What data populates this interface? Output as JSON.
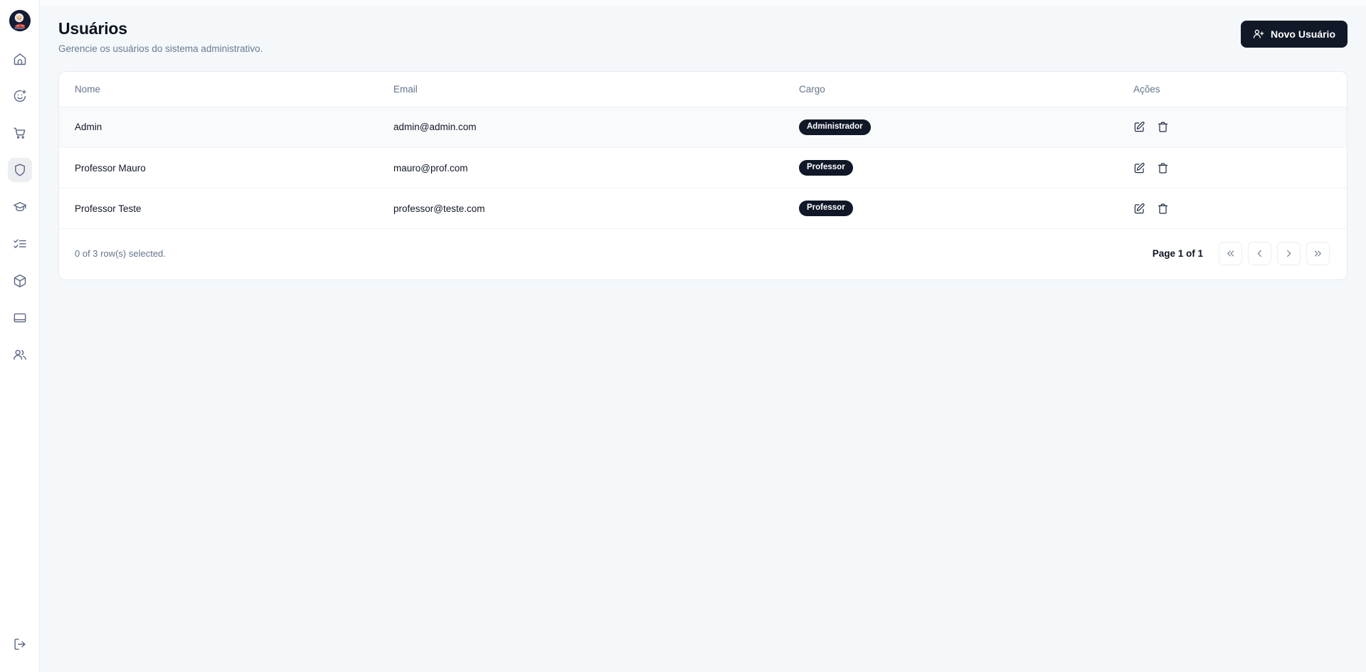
{
  "theme": {
    "accent": "#111827",
    "page_bg": "#f4f8fb",
    "card_bg": "#ffffff",
    "border": "#e6ebf2",
    "muted_text": "#64748b",
    "sidebar_icon": "#5b6785"
  },
  "sidebar": {
    "avatar_name": "user-avatar-astronaut",
    "items": [
      {
        "name": "sidebar-item-home",
        "icon": "home-icon",
        "active": false
      },
      {
        "name": "sidebar-item-add-user",
        "icon": "smiley-plus-icon",
        "active": false
      },
      {
        "name": "sidebar-item-store",
        "icon": "cart-icon",
        "active": false
      },
      {
        "name": "sidebar-item-admin",
        "icon": "shield-icon",
        "active": true
      },
      {
        "name": "sidebar-item-courses",
        "icon": "graduation-cap-icon",
        "active": false
      },
      {
        "name": "sidebar-item-tasks",
        "icon": "checklist-icon",
        "active": false
      },
      {
        "name": "sidebar-item-products",
        "icon": "box-icon",
        "active": false
      },
      {
        "name": "sidebar-item-library",
        "icon": "book-icon",
        "active": false
      },
      {
        "name": "sidebar-item-users",
        "icon": "users-icon",
        "active": false
      }
    ],
    "logout": {
      "name": "sidebar-item-logout",
      "icon": "logout-icon"
    }
  },
  "header": {
    "title": "Usuários",
    "subtitle": "Gerencie os usuários do sistema administrativo.",
    "new_user_label": "Novo Usuário",
    "new_user_icon": "user-plus-icon"
  },
  "table": {
    "columns": [
      {
        "key": "nome",
        "label": "Nome"
      },
      {
        "key": "email",
        "label": "Email"
      },
      {
        "key": "cargo",
        "label": "Cargo"
      },
      {
        "key": "acoes",
        "label": "Ações"
      }
    ],
    "rows": [
      {
        "nome": "Admin",
        "email": "admin@admin.com",
        "cargo": "Administrador",
        "selected": true
      },
      {
        "nome": "Professor Mauro",
        "email": "mauro@prof.com",
        "cargo": "Professor",
        "selected": false
      },
      {
        "nome": "Professor Teste",
        "email": "professor@teste.com",
        "cargo": "Professor",
        "selected": false
      }
    ],
    "row_actions": {
      "edit_icon": "edit-pencil-icon",
      "delete_icon": "trash-icon"
    }
  },
  "footer": {
    "rows_selected": "0 of 3 row(s) selected.",
    "page_indicator": "Page 1 of 1",
    "pager": [
      {
        "name": "pagination-first-button",
        "icon": "chevrons-left-icon"
      },
      {
        "name": "pagination-previous-button",
        "icon": "chevron-left-icon"
      },
      {
        "name": "pagination-next-button",
        "icon": "chevron-right-icon"
      },
      {
        "name": "pagination-last-button",
        "icon": "chevrons-right-icon"
      }
    ]
  }
}
